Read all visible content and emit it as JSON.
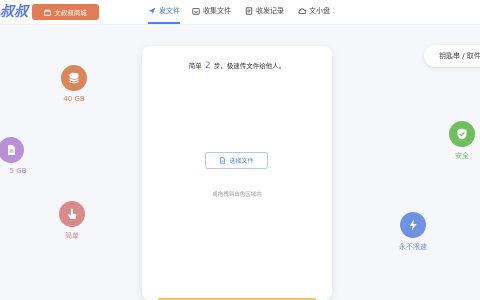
{
  "header": {
    "logo_text": "叔叔",
    "mall_button": "文叔叔商城",
    "tabs": [
      {
        "label": "发文件",
        "icon": "send-icon",
        "active": true
      },
      {
        "label": "收集文件",
        "icon": "collect-icon",
        "active": false
      },
      {
        "label": "收发记录",
        "icon": "record-icon",
        "active": false
      },
      {
        "label": "文小盘",
        "icon": "cloud-icon",
        "active": false
      }
    ]
  },
  "right_pill": "钥匙串 / 取件",
  "card": {
    "intro_prefix": "简单",
    "intro_number": "2",
    "intro_suffix": "步，极速传文件给他人。",
    "choose_button": "选择文件",
    "drag_hint": "或拖拽到白色区域内"
  },
  "features": [
    {
      "label": "40 GB",
      "icon": "database-icon",
      "color": "#d9875a"
    },
    {
      "label": "5 GB",
      "icon": "document-icon",
      "color": "#b98fd6"
    },
    {
      "label": "简单",
      "icon": "pointer-icon",
      "color": "#d98a8a"
    },
    {
      "label": "安全",
      "icon": "shield-check-icon",
      "color": "#6fbf5e"
    },
    {
      "label": "永不限速",
      "icon": "lightning-icon",
      "color": "#6f93e0"
    }
  ]
}
